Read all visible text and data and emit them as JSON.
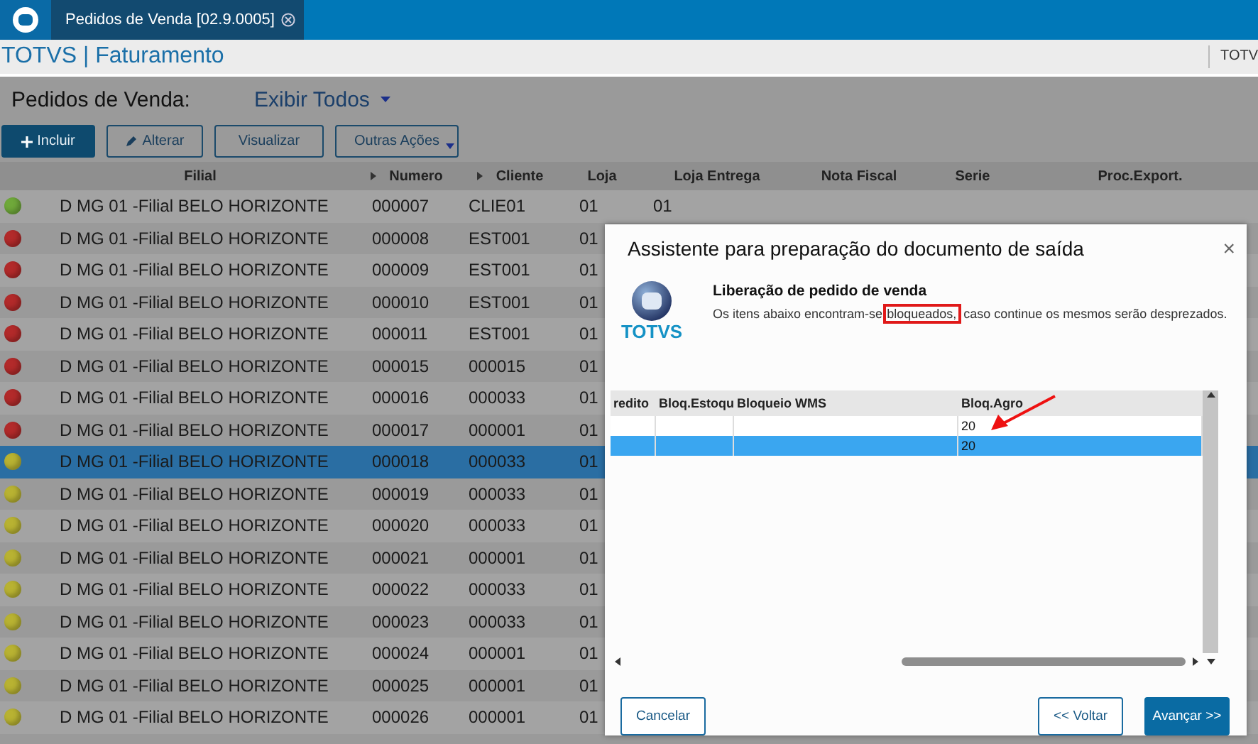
{
  "top_bar": {
    "tab": {
      "label": "Pedidos de Venda [02.9.0005]",
      "selected": true
    }
  },
  "app_header": {
    "title": "TOTVS | Faturamento",
    "user": "TOTV"
  },
  "page": {
    "label": "Pedidos de Venda:",
    "filter": "Exibir Todos"
  },
  "actions": [
    {
      "label": "Incluir",
      "kind": "primary"
    },
    {
      "label": "Alterar",
      "kind": "edit"
    },
    {
      "label": "Visualizar",
      "kind": "plain"
    },
    {
      "label": "Outras Ações",
      "kind": "menu"
    }
  ],
  "table": {
    "columns": [
      {
        "label": "Filial",
        "sortable": false
      },
      {
        "label": "Numero",
        "sortable": true
      },
      {
        "label": "Cliente",
        "sortable": true
      },
      {
        "label": "Loja",
        "sortable": false
      },
      {
        "label": "Loja Entrega",
        "sortable": false
      },
      {
        "label": "Nota Fiscal",
        "sortable": false
      },
      {
        "label": "Serie",
        "sortable": false
      },
      {
        "label": "Proc.Export.",
        "sortable": false
      }
    ],
    "rows": [
      {
        "color": "#6fa83a",
        "filial": "D MG 01 -Filial BELO HORIZONTE",
        "numero": "000007",
        "cliente": "CLIE01",
        "loja": "01",
        "loja_entrega": "01",
        "selected": false
      },
      {
        "color": "#b22a2a",
        "filial": "D MG 01 -Filial BELO HORIZONTE",
        "numero": "000008",
        "cliente": "EST001",
        "loja": "01",
        "selected": false
      },
      {
        "color": "#b22a2a",
        "filial": "D MG 01 -Filial BELO HORIZONTE",
        "numero": "000009",
        "cliente": "EST001",
        "loja": "01",
        "selected": false
      },
      {
        "color": "#b22a2a",
        "filial": "D MG 01 -Filial BELO HORIZONTE",
        "numero": "000010",
        "cliente": "EST001",
        "loja": "01",
        "selected": false
      },
      {
        "color": "#b22a2a",
        "filial": "D MG 01 -Filial BELO HORIZONTE",
        "numero": "000011",
        "cliente": "EST001",
        "loja": "01",
        "selected": false
      },
      {
        "color": "#b22a2a",
        "filial": "D MG 01 -Filial BELO HORIZONTE",
        "numero": "000015",
        "cliente": "000015",
        "loja": "01",
        "selected": false
      },
      {
        "color": "#b22a2a",
        "filial": "D MG 01 -Filial BELO HORIZONTE",
        "numero": "000016",
        "cliente": "000033",
        "loja": "01",
        "selected": false
      },
      {
        "color": "#b22a2a",
        "filial": "D MG 01 -Filial BELO HORIZONTE",
        "numero": "000017",
        "cliente": "000001",
        "loja": "01",
        "selected": false
      },
      {
        "color": "#b8b232",
        "filial": "D MG 01 -Filial BELO HORIZONTE",
        "numero": "000018",
        "cliente": "000033",
        "loja": "01",
        "selected": true
      },
      {
        "color": "#b8b232",
        "filial": "D MG 01 -Filial BELO HORIZONTE",
        "numero": "000019",
        "cliente": "000033",
        "loja": "01",
        "selected": false
      },
      {
        "color": "#b8b232",
        "filial": "D MG 01 -Filial BELO HORIZONTE",
        "numero": "000020",
        "cliente": "000033",
        "loja": "01",
        "selected": false
      },
      {
        "color": "#b8b232",
        "filial": "D MG 01 -Filial BELO HORIZONTE",
        "numero": "000021",
        "cliente": "000001",
        "loja": "01",
        "selected": false
      },
      {
        "color": "#b8b232",
        "filial": "D MG 01 -Filial BELO HORIZONTE",
        "numero": "000022",
        "cliente": "000033",
        "loja": "01",
        "selected": false
      },
      {
        "color": "#b8b232",
        "filial": "D MG 01 -Filial BELO HORIZONTE",
        "numero": "000023",
        "cliente": "000033",
        "loja": "01",
        "selected": false
      },
      {
        "color": "#b8b232",
        "filial": "D MG 01 -Filial BELO HORIZONTE",
        "numero": "000024",
        "cliente": "000001",
        "loja": "01",
        "selected": false
      },
      {
        "color": "#b8b232",
        "filial": "D MG 01 -Filial BELO HORIZONTE",
        "numero": "000025",
        "cliente": "000001",
        "loja": "01",
        "selected": false
      },
      {
        "color": "#b8b232",
        "filial": "D MG 01 -Filial BELO HORIZONTE",
        "numero": "000026",
        "cliente": "000001",
        "loja": "01",
        "selected": false
      }
    ]
  },
  "dialog": {
    "title": "Assistente para preparação do documento de saída",
    "close": "×",
    "logo_text": "TOTVS",
    "heading": "Liberação de pedido de venda",
    "message": {
      "before": "Os itens abaixo encontram-se",
      "highlighted": "bloqueados,",
      "after": "caso continue os mesmos serão desprezados."
    },
    "table": {
      "columns": [
        "redito",
        "Bloq.Estoqu",
        "Bloqueio WMS",
        "Bloq.Agro"
      ],
      "rows": [
        {
          "cells": [
            "",
            "",
            "",
            "20"
          ],
          "selected": false
        },
        {
          "cells": [
            "",
            "",
            "",
            "20"
          ],
          "selected": true
        }
      ]
    },
    "buttons": [
      {
        "label": "Cancelar",
        "kind": "secondary"
      },
      {
        "label": "<< Voltar",
        "kind": "secondary"
      },
      {
        "label": "Avançar >>",
        "kind": "primary"
      }
    ]
  }
}
